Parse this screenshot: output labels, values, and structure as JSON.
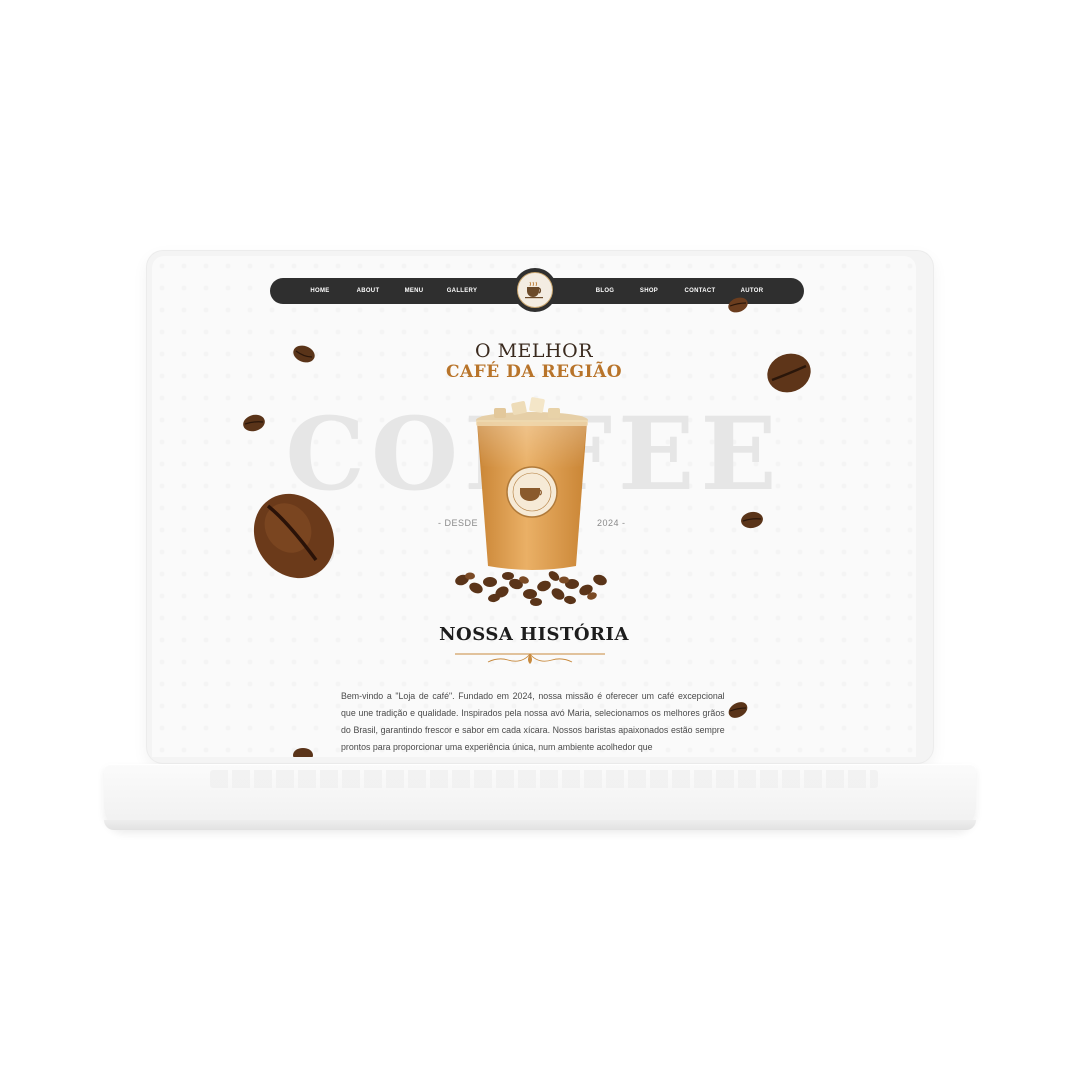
{
  "nav": {
    "items_left": [
      "HOME",
      "ABOUT",
      "MENU",
      "GALLERY"
    ],
    "items_right": [
      "BLOG",
      "SHOP",
      "CONTACT",
      "AUTOR"
    ]
  },
  "hero": {
    "line1": "O MELHOR",
    "line2": "CAFÉ DA REGIÃO",
    "background_word": "COFFEE",
    "since_label": "- DESDE",
    "since_year": "2024 -"
  },
  "story": {
    "title": "NOSSA HISTÓRIA",
    "text": "Bem-vindo a \"Loja de café\". Fundado em 2024, nossa missão é oferecer um café excepcional que une tradição e qualidade. Inspirados pela nossa avó Maria, selecionamos os melhores grãos do Brasil, garantindo frescor e sabor em cada xícara. Nossos baristas apaixonados estão sempre prontos para proporcionar uma experiência única, num ambiente acolhedor que"
  },
  "colors": {
    "nav_bg": "#2f2f2f",
    "accent": "#b8742a",
    "heading": "#1d1d1d"
  }
}
